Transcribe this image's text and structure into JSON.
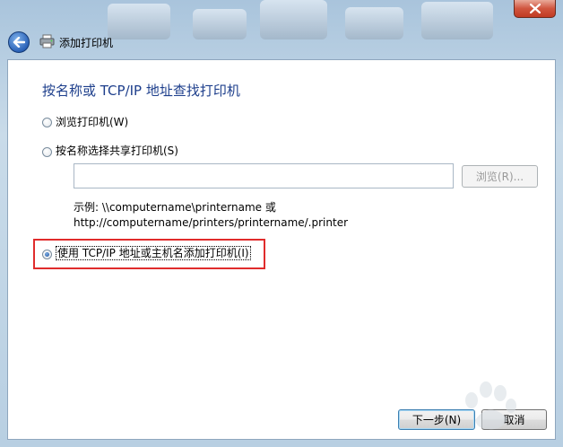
{
  "window": {
    "title": "添加打印机"
  },
  "page": {
    "heading": "按名称或 TCP/IP 地址查找打印机"
  },
  "options": [
    {
      "label": "浏览打印机(W)",
      "checked": false
    },
    {
      "label": "按名称选择共享打印机(S)",
      "checked": false
    },
    {
      "label": "使用 TCP/IP 地址或主机名添加打印机(I)",
      "checked": true
    }
  ],
  "share_field": {
    "value": "",
    "browse_label": "浏览(R)..."
  },
  "example": {
    "line1": "示例: \\\\computername\\printername 或",
    "line2": "http://computername/printers/printername/.printer"
  },
  "buttons": {
    "next": "下一步(N)",
    "cancel": "取消"
  },
  "icons": {
    "close": "close-icon",
    "back": "back-arrow-icon",
    "title": "printer-icon"
  }
}
